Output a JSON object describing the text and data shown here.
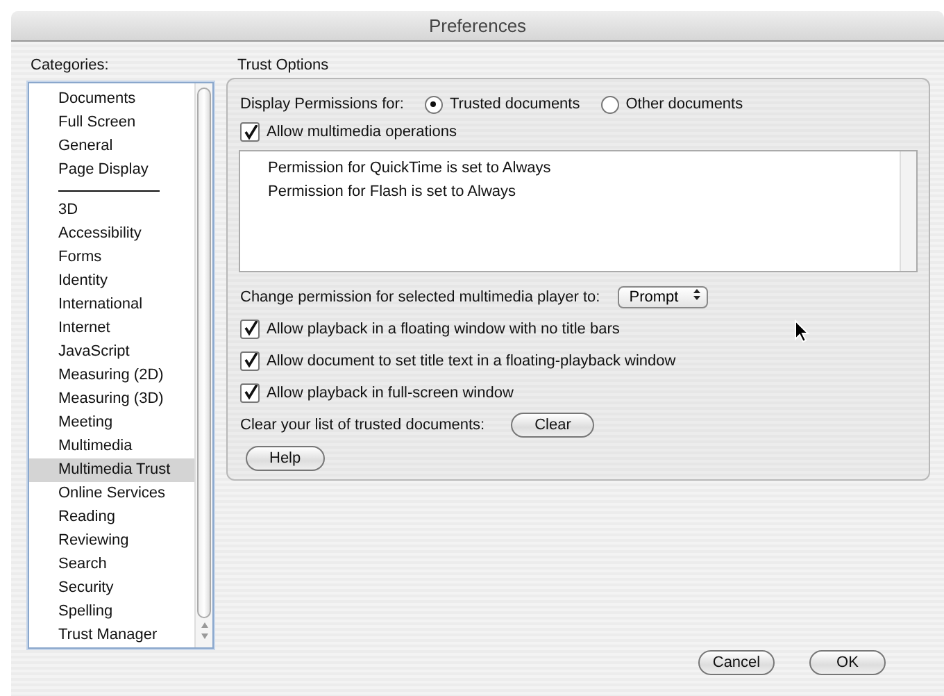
{
  "window": {
    "title": "Preferences"
  },
  "categories": {
    "label": "Categories:",
    "items": [
      {
        "kind": "item",
        "label": "Documents",
        "selected": false
      },
      {
        "kind": "item",
        "label": "Full Screen",
        "selected": false
      },
      {
        "kind": "item",
        "label": "General",
        "selected": false
      },
      {
        "kind": "item",
        "label": "Page Display",
        "selected": false
      },
      {
        "kind": "separator"
      },
      {
        "kind": "item",
        "label": "3D",
        "selected": false
      },
      {
        "kind": "item",
        "label": "Accessibility",
        "selected": false
      },
      {
        "kind": "item",
        "label": "Forms",
        "selected": false
      },
      {
        "kind": "item",
        "label": "Identity",
        "selected": false
      },
      {
        "kind": "item",
        "label": "International",
        "selected": false
      },
      {
        "kind": "item",
        "label": "Internet",
        "selected": false
      },
      {
        "kind": "item",
        "label": "JavaScript",
        "selected": false
      },
      {
        "kind": "item",
        "label": "Measuring (2D)",
        "selected": false
      },
      {
        "kind": "item",
        "label": "Measuring (3D)",
        "selected": false
      },
      {
        "kind": "item",
        "label": "Meeting",
        "selected": false
      },
      {
        "kind": "item",
        "label": "Multimedia",
        "selected": false
      },
      {
        "kind": "item",
        "label": "Multimedia Trust",
        "selected": true
      },
      {
        "kind": "item",
        "label": "Online Services",
        "selected": false
      },
      {
        "kind": "item",
        "label": "Reading",
        "selected": false
      },
      {
        "kind": "item",
        "label": "Reviewing",
        "selected": false
      },
      {
        "kind": "item",
        "label": "Search",
        "selected": false
      },
      {
        "kind": "item",
        "label": "Security",
        "selected": false
      },
      {
        "kind": "item",
        "label": "Spelling",
        "selected": false
      },
      {
        "kind": "item",
        "label": "Trust Manager",
        "selected": false
      }
    ]
  },
  "trust_options": {
    "title": "Trust Options",
    "display_for": {
      "label": "Display Permissions for:",
      "options": [
        {
          "label": "Trusted documents",
          "selected": true
        },
        {
          "label": "Other documents",
          "selected": false
        }
      ]
    },
    "allow_multimedia": {
      "label": "Allow multimedia operations",
      "checked": true
    },
    "permissions": [
      "Permission for QuickTime is set to Always",
      "Permission for Flash is set to Always"
    ],
    "change_permission": {
      "label": "Change permission for selected multimedia player to:",
      "value": "Prompt"
    },
    "options": [
      {
        "label": "Allow playback in a floating window with no title bars",
        "checked": true
      },
      {
        "label": "Allow document to set title text in a floating-playback window",
        "checked": true
      },
      {
        "label": "Allow playback in full-screen window",
        "checked": true
      }
    ],
    "clear": {
      "label": "Clear your list of trusted documents:",
      "button": "Clear"
    },
    "help_button": "Help"
  },
  "buttons": [
    "Cancel",
    "OK"
  ]
}
